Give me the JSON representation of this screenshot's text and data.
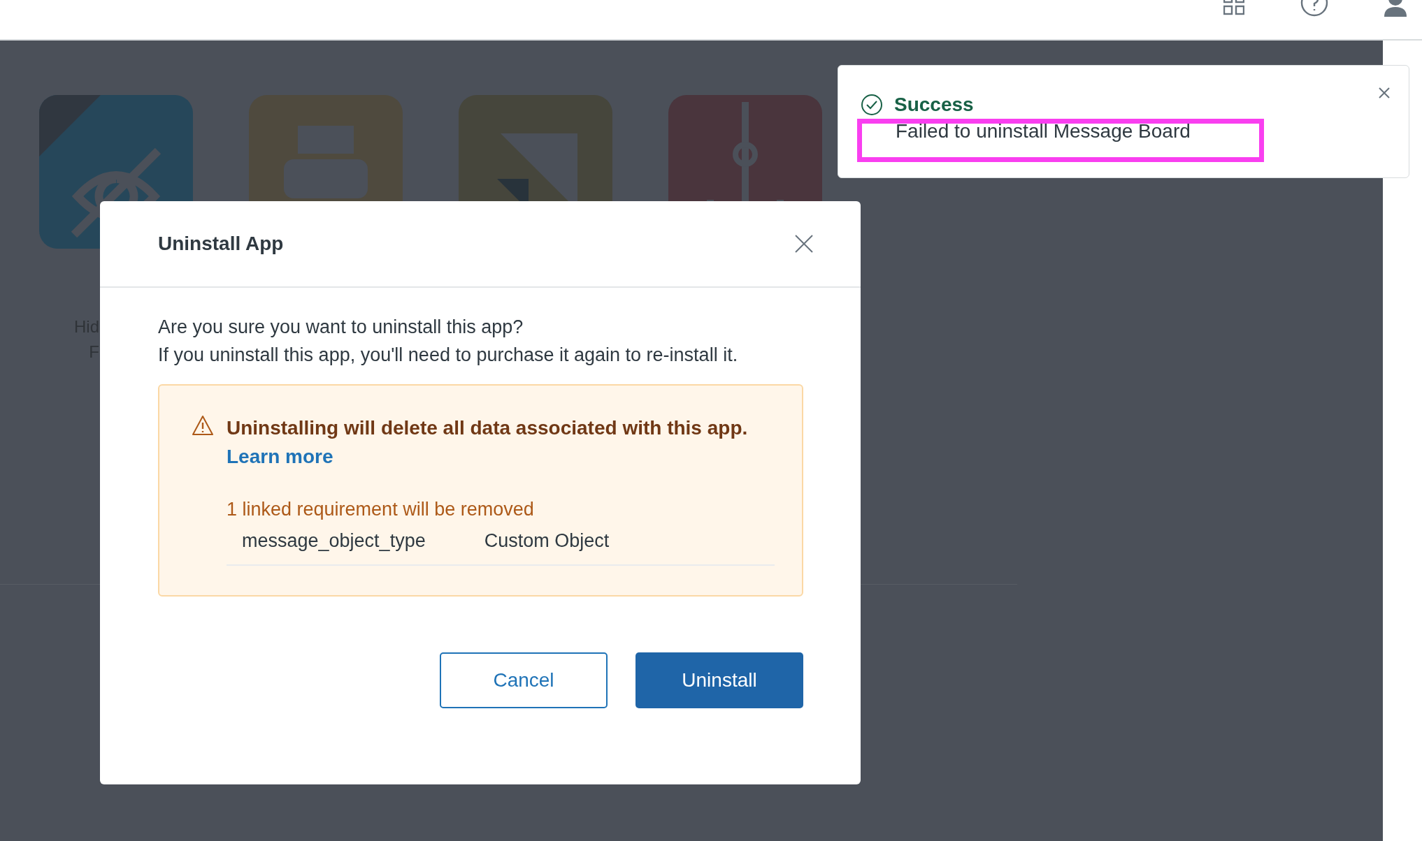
{
  "tiles": [
    {
      "kind": "eye",
      "color": "#26475a"
    },
    {
      "kind": "printer",
      "color": "#4f4a3e"
    },
    {
      "kind": "triangle",
      "color": "#46463c"
    },
    {
      "kind": "hook",
      "color": "#4a353d"
    }
  ],
  "tile_label_lines": [
    "Hid",
    "F"
  ],
  "toast": {
    "title": "Success",
    "message": "Failed to uninstall Message Board",
    "highlighted": true
  },
  "modal": {
    "title": "Uninstall App",
    "body": [
      "Are you sure you want to uninstall this app?",
      "If you uninstall this app, you'll need to purchase it again to re-install it."
    ],
    "warning": {
      "text": "Uninstalling will delete all data associated with this app.",
      "link": "Learn more",
      "requirements_title": "1 linked requirement will be removed",
      "requirements": [
        {
          "name": "message_object_type",
          "type": "Custom Object"
        }
      ]
    },
    "buttons": [
      {
        "label": "Cancel",
        "kind": "secondary"
      },
      {
        "label": "Uninstall",
        "kind": "primary"
      }
    ]
  }
}
